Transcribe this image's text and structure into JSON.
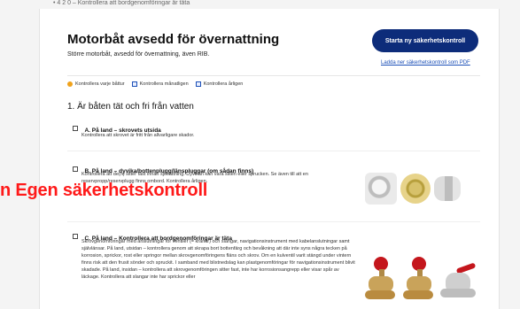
{
  "background": {
    "top_text": "• 4 2 0 – Kontrollera att bordgenomföringar är täta"
  },
  "header": {
    "title": "Motorbåt avsedd för övernattning",
    "subtitle": "Större motorbåt, avsedd för övernattning, även RIB.",
    "start_button": "Starta ny säkerhetskontroll",
    "download_link": "Ladda ner säkerhetskontroll som PDF"
  },
  "legend": {
    "items": [
      {
        "icon": "sun-icon",
        "label": "Kontrollera varje båttur"
      },
      {
        "icon": "calendar-icon",
        "label": "Kontrollera månatligen"
      },
      {
        "icon": "calendar-icon",
        "label": "Kontrollera årligen"
      }
    ]
  },
  "section": {
    "title": "1. Är båten tät och fri från vatten"
  },
  "items": {
    "a": {
      "title": "A. På land – skrovets utsida",
      "text": "Kontrollera att skrovet är fritt från allvarligare skador."
    },
    "b": {
      "title": "B. På land – dyvika/bottenplugg/länspluggar (om sådan finns)",
      "text": "Kontrollera att de(n) sitter fast innan sjösättning. Dyvikan kan vara sliten eller sprucken. Se även till att en reservpropp/reservplugg finns ombord. Kontrollera årligen."
    },
    "c": {
      "title": "C. På land – Kontrollera att bordgenomföringar är täta",
      "text": "Skrovgenomföringar med anslutningar för ventiler (= kranar) och slangar, navigationsinstrument med kabelanslutningar samt självlänsar. På land, utsidan – kontrollera genom att skrapa bort bottenfärg och bevåkning att där inte syns några tecken på korrosion, sprickor, rost eller springor mellan skrovgenomföringens fläns och skrov. Om en kulventil varit stängd under vintern finns risk att den frusit sönder och spruckit. I samband med blixtnedslag kan plastgenomföringar för navigationsinstrument blivit skadade. På land, insidan – kontrollera att skrovgenomföringen sitter fast, inte har korrosionsangrepp eller visar spår av läckage. Kontrollera att slangar inte har sprickor eller"
    }
  },
  "overlay": {
    "text": "n Egen säkerhetskontroll"
  },
  "colors": {
    "accent": "#0d2c7a",
    "link": "#1b4fb7",
    "overlay": "#ff1a1a"
  }
}
